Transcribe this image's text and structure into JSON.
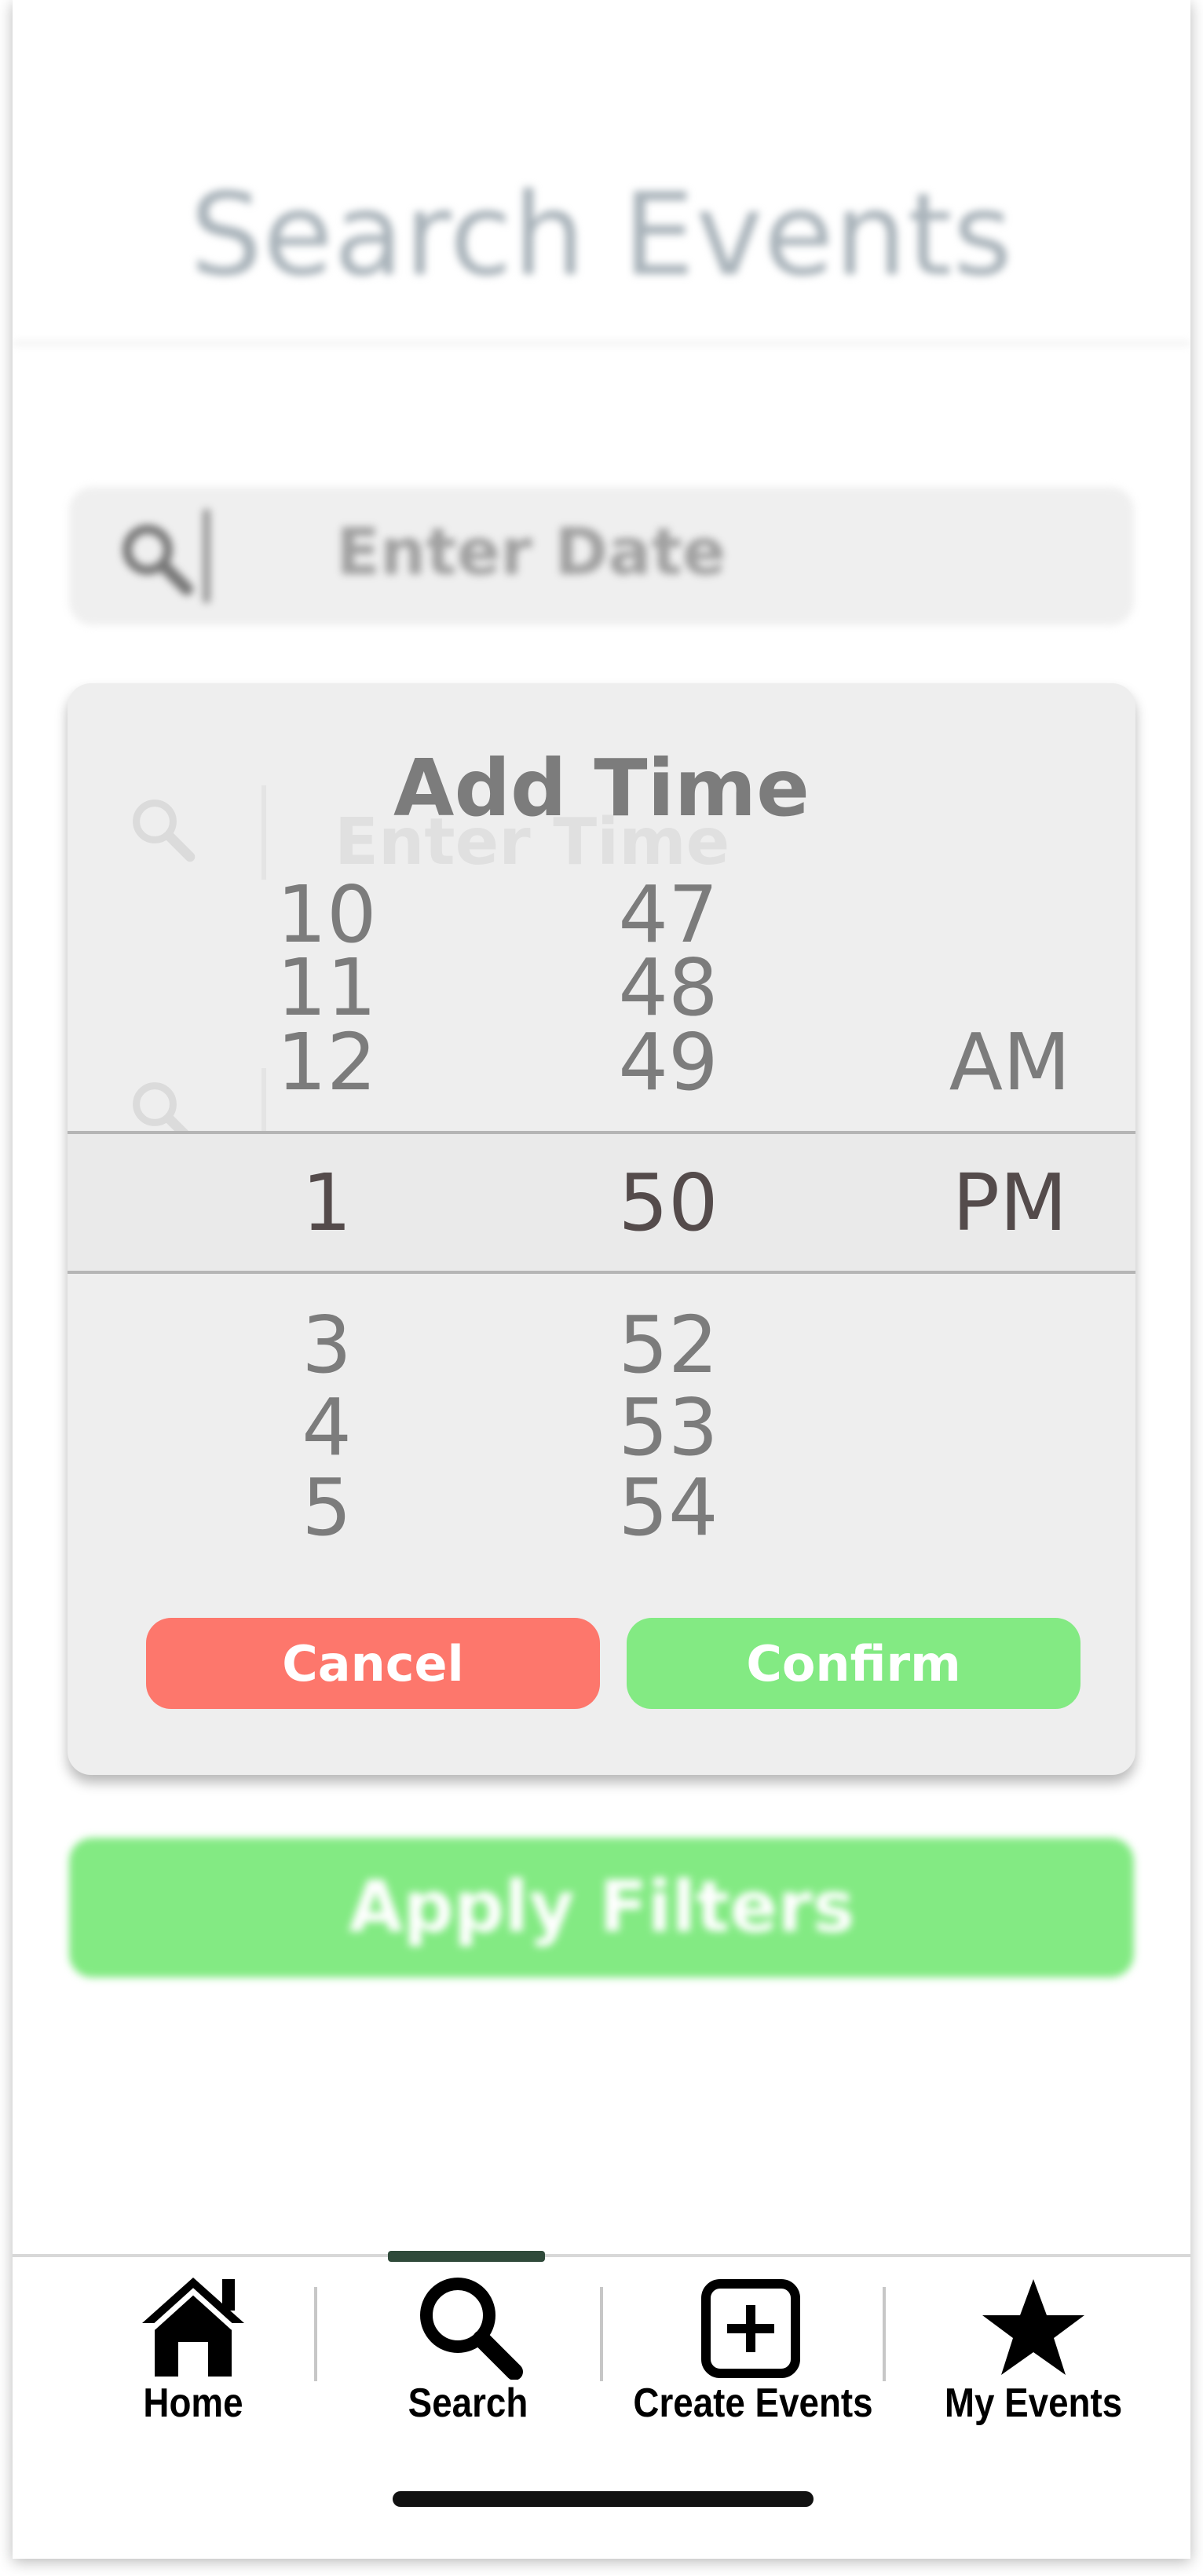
{
  "background": {
    "title": "Search Events",
    "date_placeholder": "Enter Date",
    "time_placeholder": "Enter Time",
    "apply_label": "Apply Filters"
  },
  "time_picker": {
    "title": "Add Time",
    "hours_above": [
      "10",
      "11",
      "12"
    ],
    "minutes_above": [
      "47",
      "48",
      "49"
    ],
    "ampm_above": "AM",
    "selected": {
      "hour": "1",
      "minute": "50",
      "ampm": "PM"
    },
    "hours_below": [
      "3",
      "4",
      "5"
    ],
    "minutes_below": [
      "52",
      "53",
      "54"
    ],
    "cancel_label": "Cancel",
    "confirm_label": "Confirm"
  },
  "nav": {
    "items": [
      {
        "label": "Home",
        "icon": "home-icon"
      },
      {
        "label": "Search",
        "icon": "search-icon",
        "active": true
      },
      {
        "label": "Create Events",
        "icon": "plus-square-icon"
      },
      {
        "label": "My Events",
        "icon": "star-icon"
      }
    ]
  },
  "colors": {
    "cancel": "#fd776c",
    "confirm": "#83ea83",
    "active_indicator": "#2f4a3a"
  }
}
